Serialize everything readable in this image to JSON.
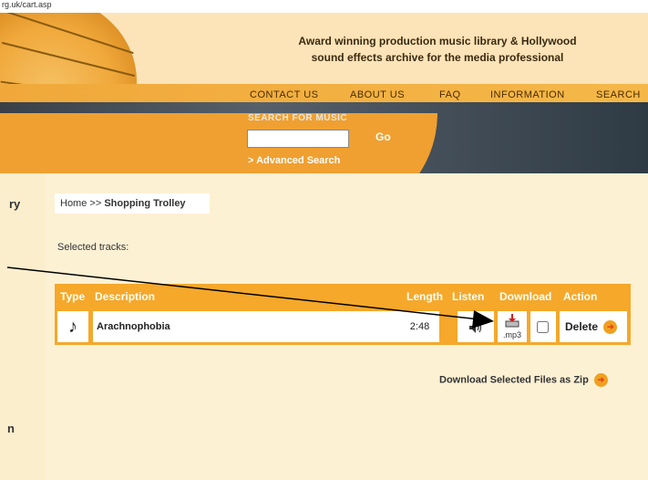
{
  "url_text": "rg.uk/cart.asp",
  "header": {
    "tagline_line1": "Award winning production music library & Hollywood",
    "tagline_line2": "sound effects archive for the media professional",
    "nav": [
      "CONTACT US",
      "ABOUT US",
      "FAQ",
      "INFORMATION",
      "SEARCH"
    ],
    "search_label": "SEARCH FOR MUSIC",
    "search_value": "",
    "go_label": "Go",
    "advanced_search": "> Advanced Search"
  },
  "left_partial": {
    "text1": "ry",
    "text2": "n"
  },
  "breadcrumb": {
    "home": "Home",
    "sep": ">>",
    "current": "Shopping Trolley"
  },
  "selected_label": "Selected tracks:",
  "table": {
    "headers": [
      "Type",
      "Description",
      "Length",
      "Listen",
      "Download",
      "Action"
    ],
    "rows": [
      {
        "type_icon": "music-note-icon",
        "description": "Arachnophobia",
        "length": "2:48",
        "download_label": ".mp3",
        "checked": false,
        "action": "Delete"
      }
    ]
  },
  "zip_link": "Download Selected Files as Zip",
  "colors": {
    "accent": "#f5a82a",
    "background": "#fdf1d4",
    "header_dark": "#3a4048"
  }
}
